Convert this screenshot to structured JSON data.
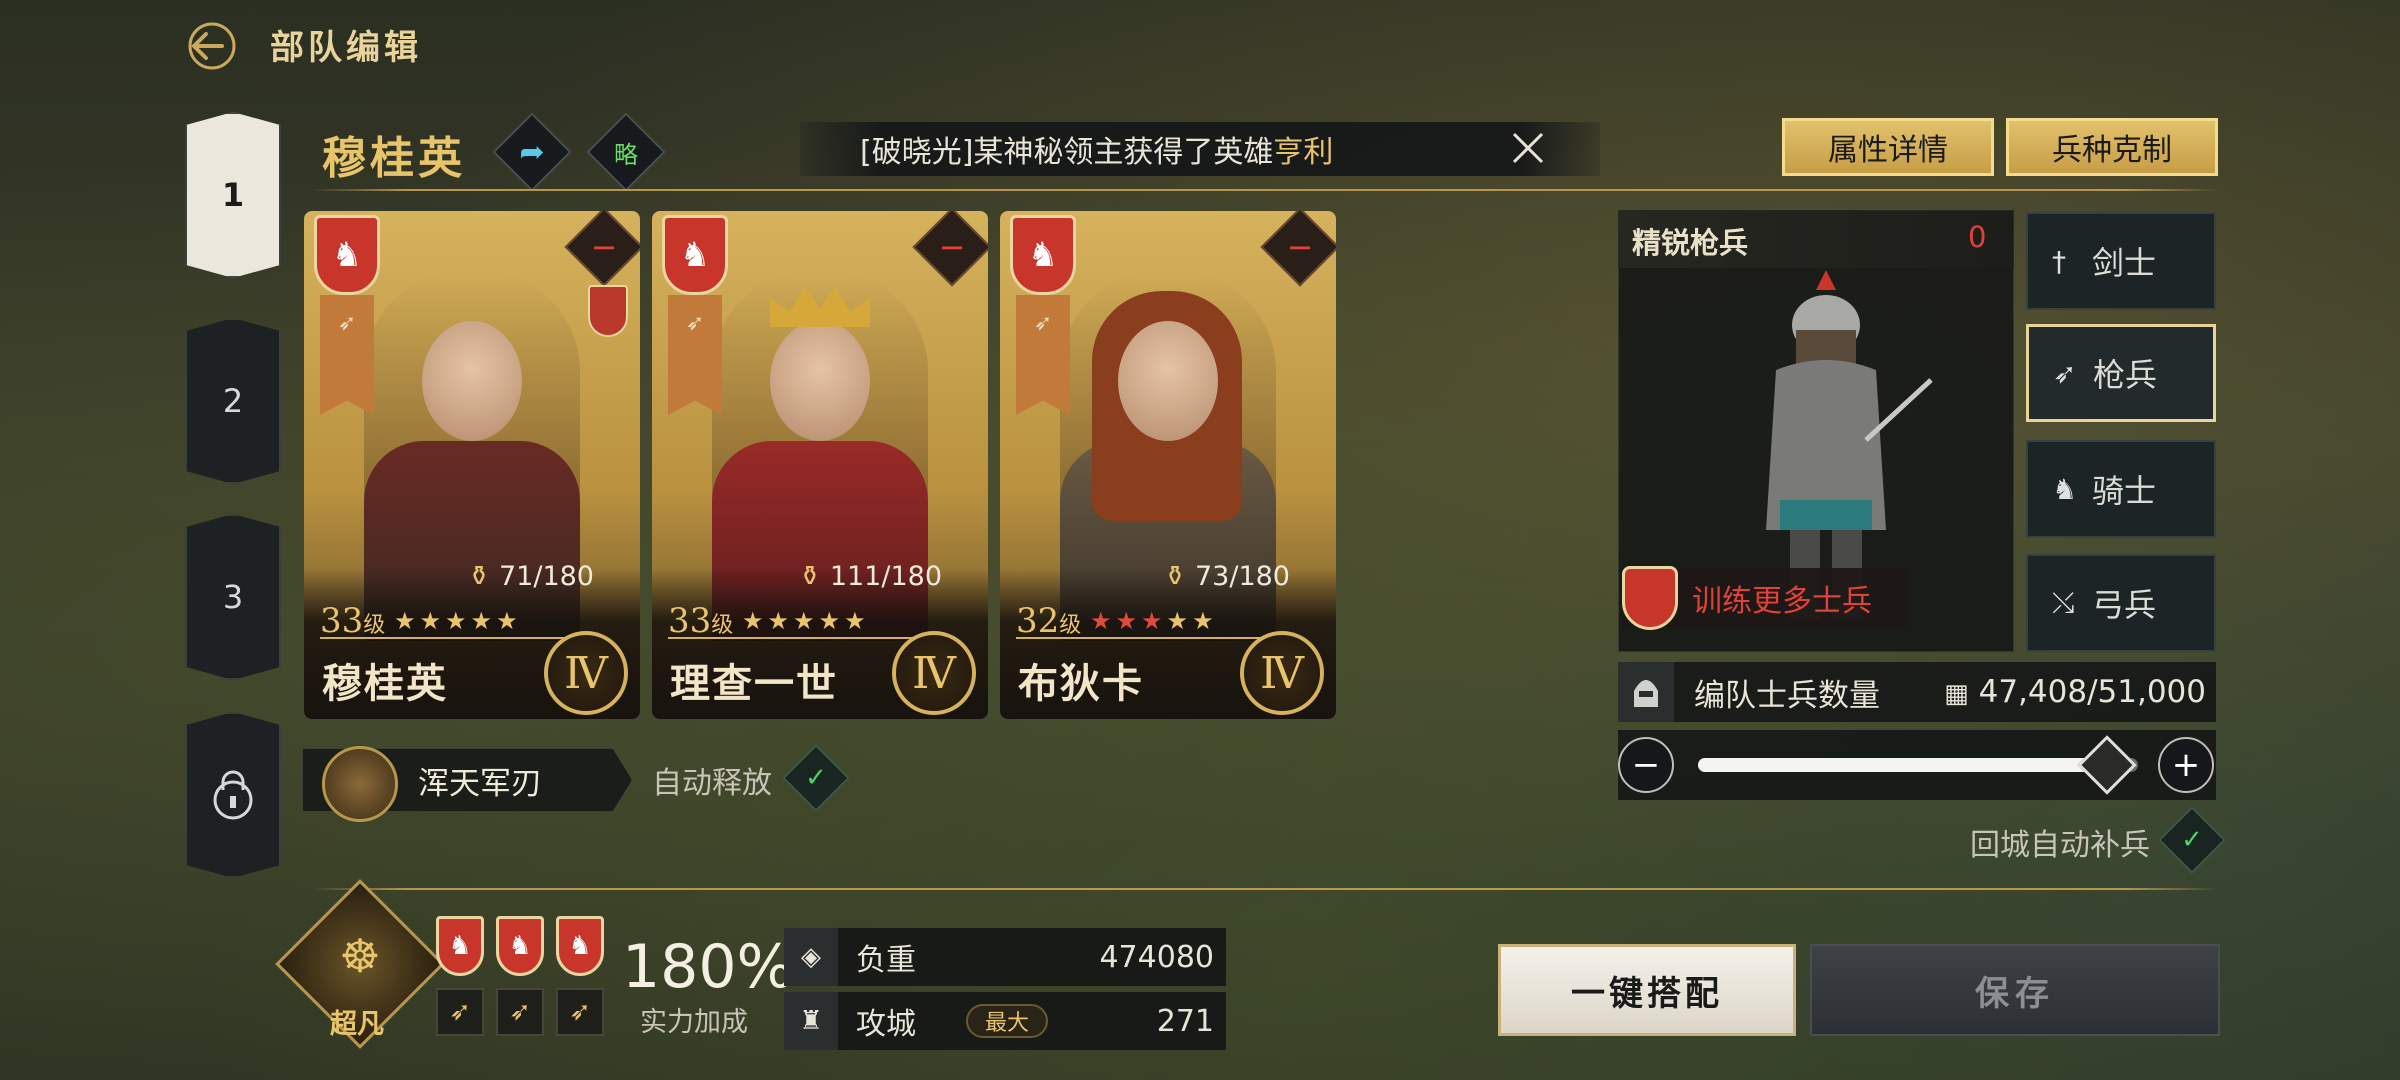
{
  "header": {
    "title": "部队编辑",
    "back_icon": "back-arrow-icon"
  },
  "slots": [
    {
      "label": "1",
      "active": true
    },
    {
      "label": "2",
      "active": false
    },
    {
      "label": "3",
      "active": false
    },
    {
      "label": "",
      "locked": true,
      "icon": "lock-icon"
    }
  ],
  "commander": {
    "name": "穆桂英",
    "share_icon": "share-arrow-icon",
    "strategy_label": "略"
  },
  "news": {
    "prefix": "[破晓光]某神秘领主获得了英雄",
    "hero": "亨利",
    "icon": "close-icon"
  },
  "buttons": {
    "attr_details": "属性详情",
    "counter": "兵种克制",
    "auto_match": "一键搭配",
    "save": "保存"
  },
  "heroes": [
    {
      "name": "穆桂英",
      "level": "33",
      "level_unit": "级",
      "exp": "71/180",
      "rank": "Ⅳ",
      "stars": "★★★★★",
      "star_color": "#e8c46a"
    },
    {
      "name": "理查一世",
      "level": "33",
      "level_unit": "级",
      "exp": "111/180",
      "rank": "Ⅳ",
      "stars": "★★★★★",
      "star_color": "#e8c46a"
    },
    {
      "name": "布狄卡",
      "level": "32",
      "level_unit": "级",
      "exp": "73/180",
      "rank": "Ⅳ",
      "stars": "★★★★★",
      "star_color": "#e04a3a"
    }
  ],
  "skill": {
    "name": "浑天军刃",
    "auto_release": "自动释放"
  },
  "troop": {
    "title": "精锐枪兵",
    "count": "0",
    "train": "训练更多士兵",
    "types": [
      {
        "label": "剑士",
        "icon": "sword-icon",
        "active": false
      },
      {
        "label": "枪兵",
        "icon": "spear-icon",
        "active": true
      },
      {
        "label": "骑士",
        "icon": "horse-icon",
        "active": false
      },
      {
        "label": "弓兵",
        "icon": "bow-icon",
        "active": false
      }
    ],
    "formation_label": "编队士兵数量",
    "formation_value": "47,408/51,000",
    "slider_fraction": 0.93,
    "auto_refill": "回城自动补兵"
  },
  "bottom": {
    "emblem_label": "超凡",
    "power_value": "180%",
    "power_label": "实力加成",
    "load_label": "负重",
    "load_value": "474080",
    "siege_label": "攻城",
    "siege_tag": "最大",
    "siege_value": "271"
  },
  "colors": {
    "accent_gold": "#e8c46a",
    "danger_red": "#e0413a",
    "check_green": "#4bd46a"
  }
}
